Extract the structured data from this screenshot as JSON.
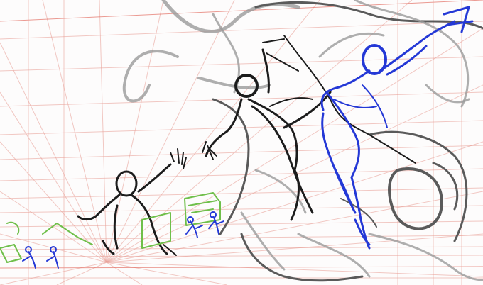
{
  "image": {
    "kind": "sketch",
    "colors": {
      "background": "#fdfcfc",
      "perspective_grid": "#e89a92",
      "sketch_gray": "#5a5a5a",
      "sketch_dark": "#1c1c1c",
      "sketch_blue": "#2438d6",
      "sketch_green": "#6fbf4a"
    }
  }
}
